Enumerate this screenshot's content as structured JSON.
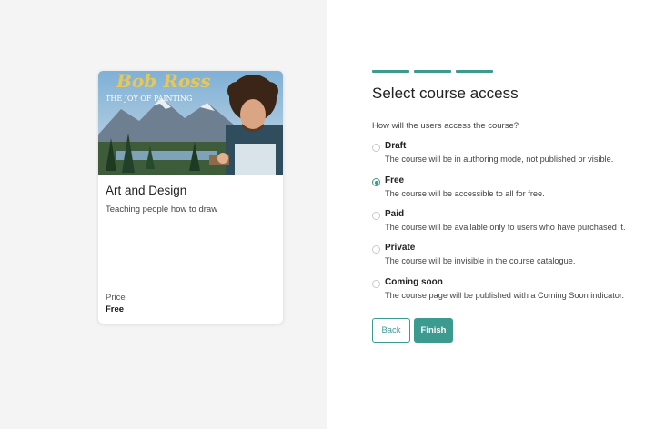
{
  "course_card": {
    "image_title": "Bob Ross",
    "image_subtitle": "THE JOY OF PAINTING",
    "title": "Art and Design",
    "description": "Teaching people how to draw",
    "price_label": "Price",
    "price_value": "Free"
  },
  "wizard": {
    "steps_total": 3,
    "steps_completed": 3,
    "heading": "Select course access",
    "question": "How will the users access the course?",
    "selected": "free",
    "options": [
      {
        "id": "draft",
        "label": "Draft",
        "description": "The course will be in authoring mode, not published or visible."
      },
      {
        "id": "free",
        "label": "Free",
        "description": "The course will be accessible to all for free."
      },
      {
        "id": "paid",
        "label": "Paid",
        "description": "The course will be available only to users who have purchased it."
      },
      {
        "id": "private",
        "label": "Private",
        "description": "The course will be invisible in the course catalogue."
      },
      {
        "id": "coming-soon",
        "label": "Coming soon",
        "description": "The course page will be published with a Coming Soon indicator."
      }
    ],
    "back_label": "Back",
    "finish_label": "Finish"
  },
  "colors": {
    "accent": "#3d9a8f",
    "left_background": "#f4f4f4"
  }
}
